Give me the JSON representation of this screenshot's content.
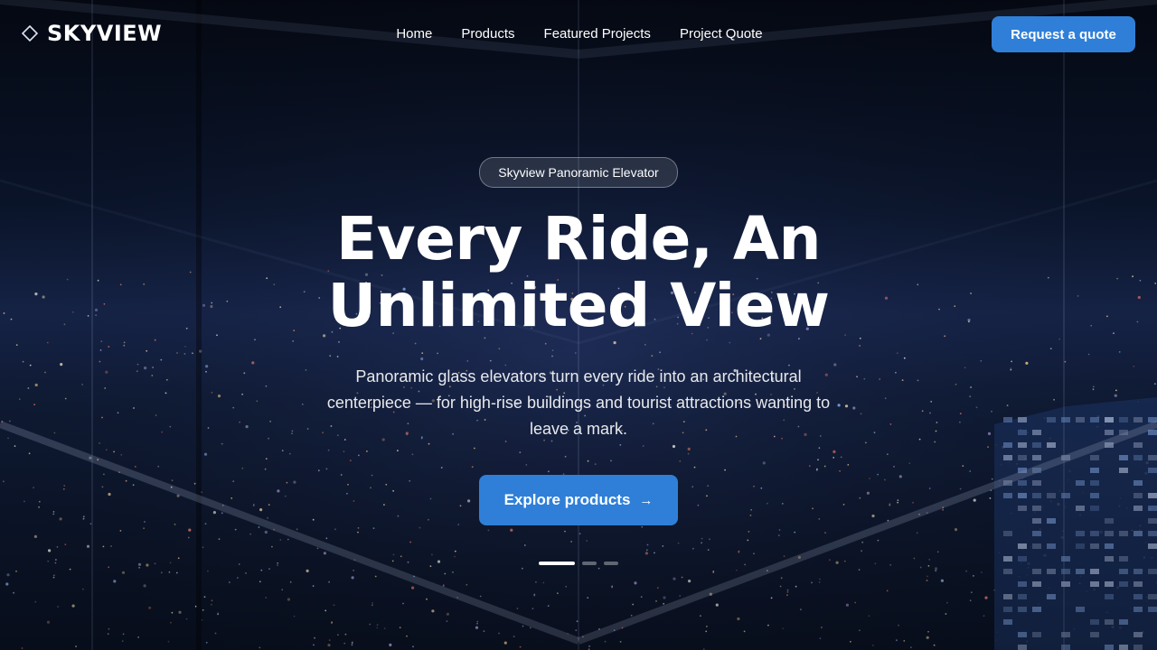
{
  "brand": {
    "name": "SKYVIEW",
    "icon": "diamond-outline-icon"
  },
  "nav": {
    "items": [
      {
        "label": "Home"
      },
      {
        "label": "Products"
      },
      {
        "label": "Featured Projects"
      },
      {
        "label": "Project Quote"
      }
    ],
    "cta_label": "Request a quote"
  },
  "hero": {
    "badge": "Skyview Panoramic Elevator",
    "title_line1": "Every Ride, An",
    "title_line2": "Unlimited View",
    "subtitle": "Panoramic glass elevators turn every ride into an architectural centerpiece — for high-rise buildings and tourist attractions wanting to leave a mark.",
    "cta_label": "Explore products",
    "cta_icon": "arrow-right-icon",
    "carousel": {
      "slides": 3,
      "active": 1
    }
  },
  "colors": {
    "accent": "#2f7fd8",
    "background": "#0a1326"
  }
}
